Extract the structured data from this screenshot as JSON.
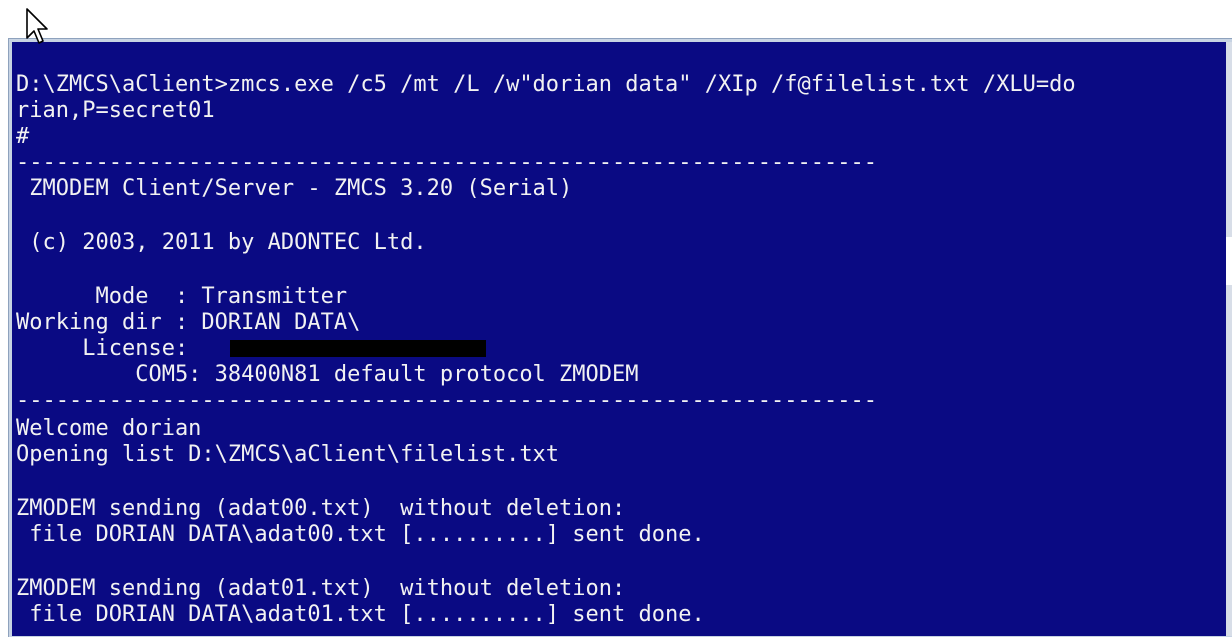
{
  "colors": {
    "console_background": "#0a0a83",
    "console_text": "#f2f2f2",
    "frame": "#c7d3e3"
  },
  "icons": {
    "cursor": "arrow-cursor-icon"
  },
  "console": {
    "lines": [
      "D:\\ZMCS\\aClient>zmcs.exe /c5 /mt /L /w\"dorian data\" /XIp /f@filelist.txt /XLU=do",
      "rian,P=secret01",
      "#",
      "-----------------------------------------------------------------",
      " ZMODEM Client/Server - ZMCS 3.20 (Serial)",
      "",
      " (c) 2003, 2011 by ADONTEC Ltd.",
      "",
      "      Mode  : Transmitter",
      "Working dir : DORIAN DATA\\",
      "     License: ",
      "         COM5: 38400N81 default protocol ZMODEM",
      "-----------------------------------------------------------------",
      "Welcome dorian",
      "Opening list D:\\ZMCS\\aClient\\filelist.txt",
      "",
      "ZMODEM sending (adat00.txt)  without deletion:",
      " file DORIAN DATA\\adat00.txt [..........] sent done.",
      "",
      "ZMODEM sending (adat01.txt)  without deletion:",
      " file DORIAN DATA\\adat01.txt [..........] sent done."
    ]
  }
}
